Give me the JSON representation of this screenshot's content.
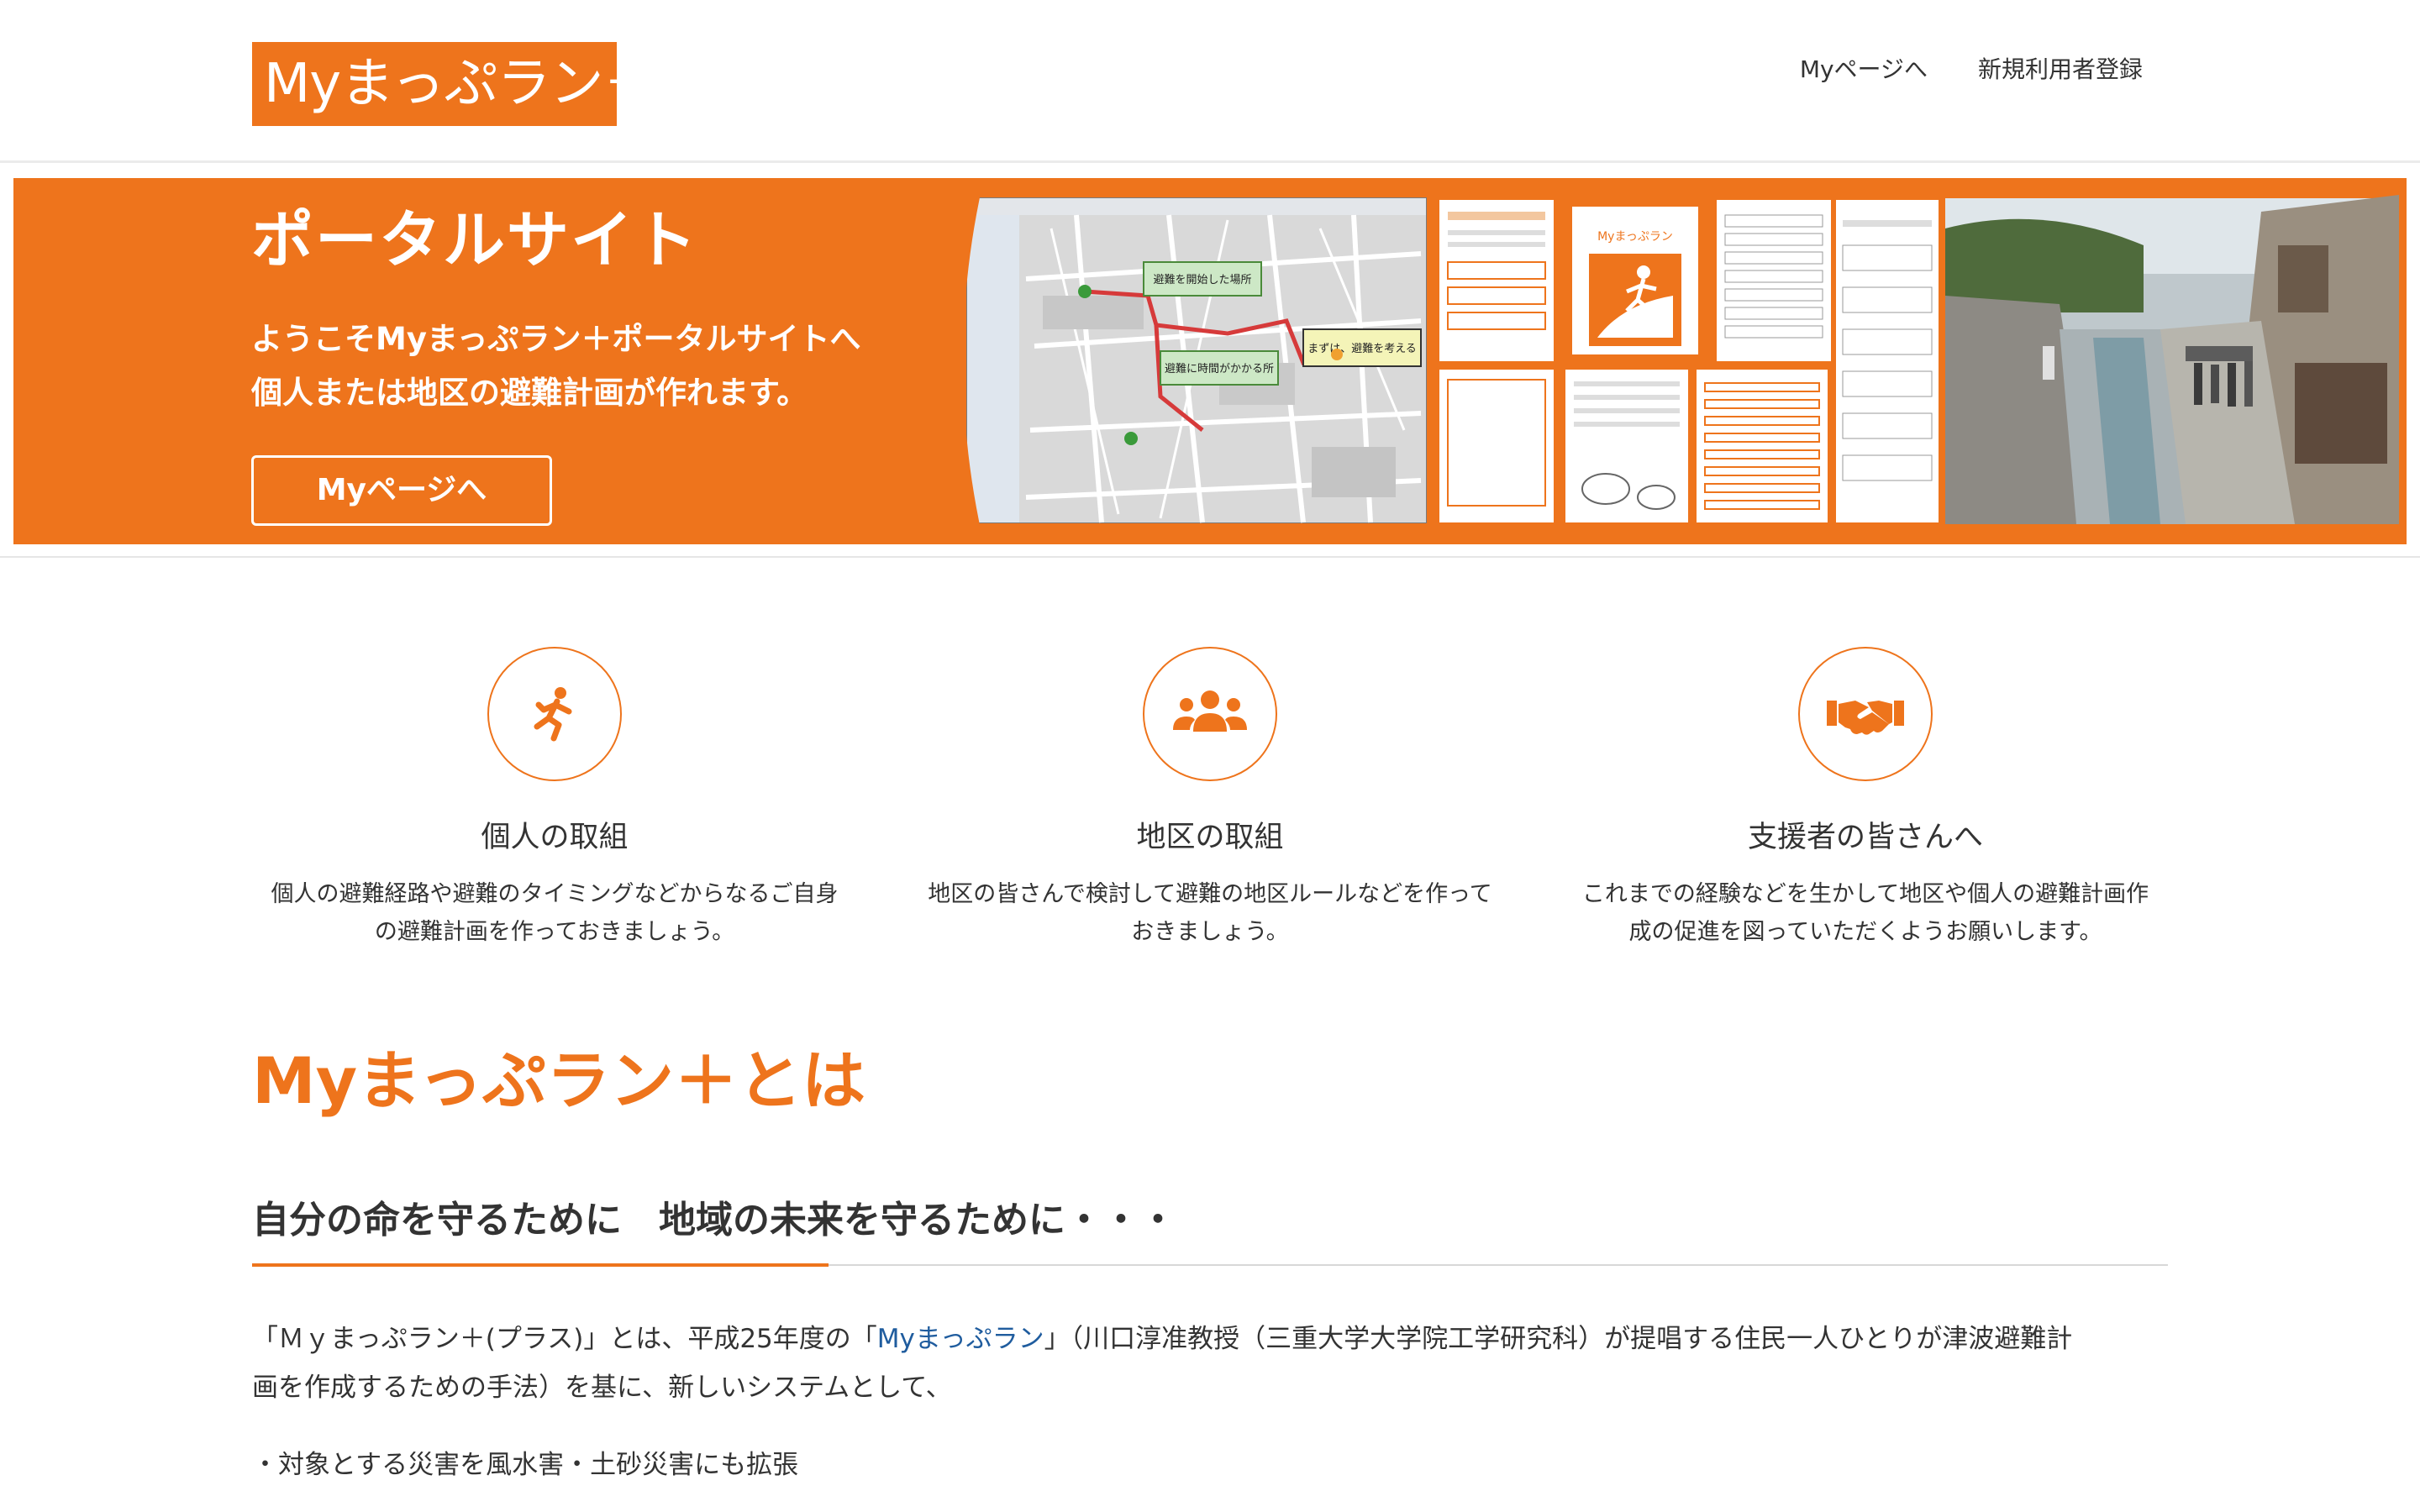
{
  "header": {
    "logo_text": "Myまっぷラン＋",
    "nav": [
      "Myページへ",
      "新規利用者登録"
    ]
  },
  "hero": {
    "title": "ポータルサイト",
    "lines": [
      "ようこそMyまっぷラン＋ポータルサイトへ",
      "個人または地区の避難計画が作れます。"
    ],
    "button_label": "Myページへ",
    "map_callouts": [
      "避難を開始した場所",
      "まずは、避難を考える",
      "避難に時間がかかる所"
    ],
    "sheet_label": "Myまっぷラン"
  },
  "features": [
    {
      "icon": "running-person-icon",
      "title": "個人の取組",
      "desc_lines": [
        "個人の避難経路や避難のタイミングなどからなるご自身",
        "の避難計画を作っておきましょう。"
      ]
    },
    {
      "icon": "group-users-icon",
      "title": "地区の取組",
      "desc_lines": [
        "地区の皆さんで検討して避難の地区ルールなどを作って",
        "おきましょう。"
      ]
    },
    {
      "icon": "handshake-icon",
      "title": "支援者の皆さんへ",
      "desc_lines": [
        "これまでの経験などを生かして地区や個人の避難計画作",
        "成の促進を図っていただくようお願いします。"
      ]
    }
  ],
  "about": {
    "title": "Myまっぷラン＋とは",
    "subtitle": "自分の命を守るために　地域の未来を守るために・・・",
    "para_pre": "「Ｍｙまっぷラン＋(プラス)」とは、平成25年度の「",
    "para_link": "Myまっぷラン",
    "para_post": "」（川口淳准教授（三重大学大学院工学研究科）が提唱する住民一人ひとりが津波避難計",
    "para_line2": "画を作成するための手法）を基に、新しいシステムとして、",
    "bullet1": "・対象とする災害を風水害・土砂災害にも拡張"
  },
  "colors": {
    "accent": "#ee741c",
    "link": "#1f5c9e",
    "text": "#333333"
  }
}
